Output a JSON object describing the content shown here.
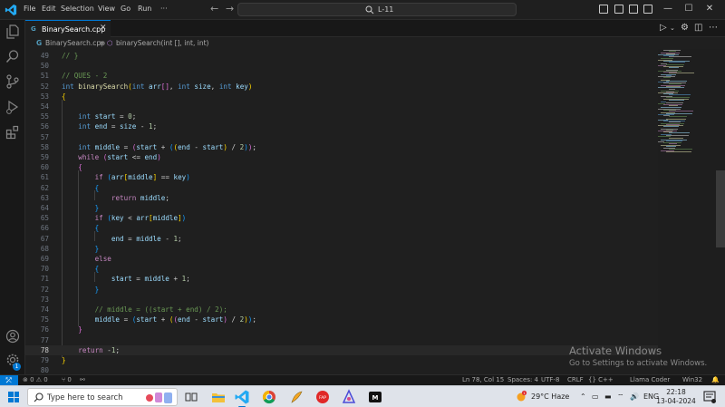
{
  "titlebar": {
    "menu": [
      "File",
      "Edit",
      "Selection",
      "View",
      "Go",
      "Run",
      "···"
    ],
    "search_text": "L-11",
    "window_controls": [
      "minimize-icon",
      "maximize-icon",
      "close-icon"
    ]
  },
  "tab": {
    "label": "BinarySearch.cpp",
    "icon_text": "G"
  },
  "breadcrumb": {
    "file": "BinarySearch.cpp",
    "sep": ">",
    "symbol": "binarySearch(int [], int, int)"
  },
  "editor": {
    "lines": [
      {
        "n": "49",
        "t": "// }"
      },
      {
        "n": "50",
        "t": ""
      },
      {
        "n": "51",
        "t": "// QUES - 2"
      },
      {
        "n": "52",
        "t": "int binarySearch(int arr[], int size, int key)"
      },
      {
        "n": "53",
        "t": "{"
      },
      {
        "n": "54",
        "t": ""
      },
      {
        "n": "55",
        "t": "    int start = 0;"
      },
      {
        "n": "56",
        "t": "    int end = size - 1;"
      },
      {
        "n": "57",
        "t": ""
      },
      {
        "n": "58",
        "t": "    int middle = (start + ((end - start) / 2));"
      },
      {
        "n": "59",
        "t": "    while (start <= end)"
      },
      {
        "n": "60",
        "t": "    {"
      },
      {
        "n": "61",
        "t": "        if (arr[middle] == key)"
      },
      {
        "n": "62",
        "t": "        {"
      },
      {
        "n": "63",
        "t": "            return middle;"
      },
      {
        "n": "64",
        "t": "        }"
      },
      {
        "n": "65",
        "t": "        if (key < arr[middle])"
      },
      {
        "n": "66",
        "t": "        {"
      },
      {
        "n": "67",
        "t": "            end = middle - 1;"
      },
      {
        "n": "68",
        "t": "        }"
      },
      {
        "n": "69",
        "t": "        else"
      },
      {
        "n": "70",
        "t": "        {"
      },
      {
        "n": "71",
        "t": "            start = middle + 1;"
      },
      {
        "n": "72",
        "t": "        }"
      },
      {
        "n": "73",
        "t": ""
      },
      {
        "n": "74",
        "t": "        // middle = ((start + end) / 2);"
      },
      {
        "n": "75",
        "t": "        middle = (start + ((end - start) / 2));"
      },
      {
        "n": "76",
        "t": "    }"
      },
      {
        "n": "77",
        "t": ""
      },
      {
        "n": "78",
        "t": "    return -1;"
      },
      {
        "n": "79",
        "t": "}"
      },
      {
        "n": "80",
        "t": ""
      }
    ],
    "current_line": "78"
  },
  "watermark": {
    "title": "Activate Windows",
    "subtitle": "Go to Settings to activate Windows."
  },
  "statusbar": {
    "remote": "⤱",
    "errors": "⊗ 0 ⚠ 0",
    "ports": "⑂ 0",
    "position": "Ln 78, Col 15",
    "spaces": "Spaces: 4",
    "encoding": "UTF-8",
    "eol": "CRLF",
    "language": "{} C++",
    "extension": "Llama Coder",
    "platform": "Win32",
    "bell": "🔔"
  },
  "taskbar": {
    "search_placeholder": "Type here to search",
    "weather": "29°C  Haze",
    "language": "ENG",
    "time": "22:18",
    "date": "13-04-2024"
  },
  "colors": {
    "accent": "#0078d4",
    "editor_bg": "#1f1f1f",
    "keyword": "#569cd6",
    "function": "#dcdcaa",
    "variable": "#9cdcfe",
    "number": "#b5cea8",
    "comment": "#6a9955"
  }
}
